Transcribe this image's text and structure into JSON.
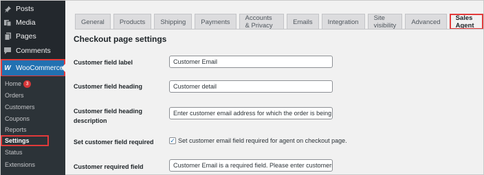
{
  "sidebar": {
    "items": [
      {
        "label": "Posts",
        "icon": "pin-icon"
      },
      {
        "label": "Media",
        "icon": "media-icon"
      },
      {
        "label": "Pages",
        "icon": "pages-icon"
      },
      {
        "label": "Comments",
        "icon": "comments-icon"
      }
    ],
    "woocommerce": {
      "label": "WooCommerce",
      "icon": "woo-icon",
      "highlight": "#2271b1"
    },
    "submenu": [
      {
        "label": "Home",
        "badge": "3"
      },
      {
        "label": "Orders"
      },
      {
        "label": "Customers"
      },
      {
        "label": "Coupons"
      },
      {
        "label": "Reports"
      },
      {
        "label": "Settings"
      },
      {
        "label": "Status"
      },
      {
        "label": "Extensions"
      }
    ]
  },
  "tabs": [
    "General",
    "Products",
    "Shipping",
    "Payments",
    "Accounts & Privacy",
    "Emails",
    "Integration",
    "Site visibility",
    "Advanced",
    "Sales Agent"
  ],
  "active_tab": "Sales Agent",
  "page": {
    "title": "Checkout page settings",
    "fields": [
      {
        "label": "Customer field label",
        "value": "Customer Email"
      },
      {
        "label": "Customer field heading",
        "value": "Customer detail"
      },
      {
        "label": "Customer field heading description",
        "value": "Enter customer email address for which the order is being plac"
      },
      {
        "label": "Set customer field required",
        "checkbox_label": "Set customer email field required for agent on checkout page.",
        "checked": true
      },
      {
        "label": "Customer required field error",
        "value": "Customer Email is a required field. Please enter customers ema"
      }
    ]
  },
  "colors": {
    "highlight_box": "#e23a3a",
    "accent": "#2271b1"
  }
}
